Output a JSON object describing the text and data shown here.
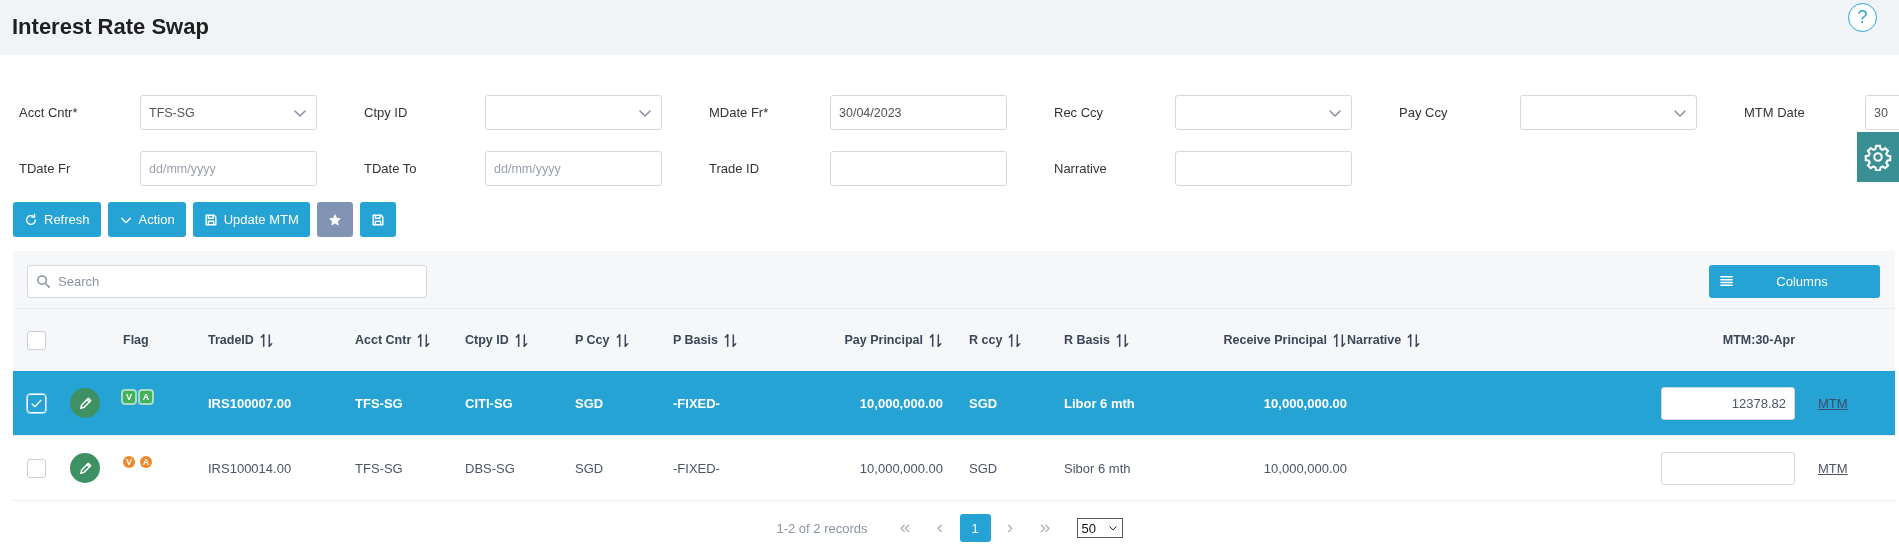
{
  "title": "Interest Rate Swap",
  "help": "?",
  "filters": [
    {
      "label": "Acct Cntr*",
      "kind": "select",
      "value": "TFS-SG"
    },
    {
      "label": "Ctpy ID",
      "kind": "select"
    },
    {
      "label": "MDate Fr*",
      "kind": "text",
      "value": "30/04/2023"
    },
    {
      "label": "Rec Ccy",
      "kind": "select"
    },
    {
      "label": "Pay Ccy",
      "kind": "select"
    },
    {
      "label": "MTM Date",
      "kind": "text",
      "value": "30"
    },
    {
      "label": "TDate Fr",
      "kind": "text",
      "placeholder": "dd/mm/yyyy"
    },
    {
      "label": "TDate To",
      "kind": "text",
      "placeholder": "dd/mm/yyyy"
    },
    {
      "label": "Trade ID",
      "kind": "text"
    },
    {
      "label": "Narrative",
      "kind": "text"
    }
  ],
  "toolbar": [
    {
      "label": "Refresh",
      "kind": "primary"
    },
    {
      "label": "Action",
      "kind": "primary"
    },
    {
      "label": "Update MTM",
      "kind": "primary"
    },
    {
      "kind": "muted"
    },
    {
      "kind": "primary"
    }
  ],
  "table": {
    "search": {
      "placeholder": "Search"
    },
    "columns_button": "Columns",
    "header_checked": false,
    "columns": [
      {
        "label": "Flag",
        "sortable": false
      },
      {
        "label": "TradeID",
        "sortable": true
      },
      {
        "label": "Acct Cntr",
        "sortable": true
      },
      {
        "label": "Ctpy ID",
        "sortable": true
      },
      {
        "label": "P Ccy",
        "sortable": true
      },
      {
        "label": "P Basis",
        "sortable": true
      },
      {
        "label": "Pay Principal",
        "sortable": true,
        "kind": "amount"
      },
      {
        "label": "R ccy",
        "sortable": true
      },
      {
        "label": "R Basis",
        "sortable": true
      },
      {
        "label": "Receive Principal",
        "sortable": true,
        "kind": "amount"
      },
      {
        "label": "Narrative",
        "sortable": true
      },
      {
        "label": "MTM:30-Apr",
        "sortable": false,
        "kind": "amount"
      }
    ],
    "rows": [
      {
        "selected": true,
        "checked": true,
        "flags": [
          {
            "label": "V",
            "kind": "box",
            "color": "#43b15a"
          },
          {
            "label": "A",
            "kind": "box",
            "color": "#43b15a"
          }
        ],
        "cells": [
          "",
          "IRS100007.00",
          "TFS-SG",
          "CITI-SG",
          "SGD",
          "-FIXED-",
          "10,000,000.00",
          "SGD",
          "Libor 6 mth",
          "10,000,000.00"
        ],
        "mtm": "12378.82",
        "link": "MTM"
      },
      {
        "selected": false,
        "checked": false,
        "flags": [
          {
            "label": "V",
            "kind": "dot",
            "color": "#f0882a"
          },
          {
            "label": "A",
            "kind": "dot",
            "color": "#f0882a"
          }
        ],
        "cells": [
          "",
          "IRS100014.00",
          "TFS-SG",
          "DBS-SG",
          "SGD",
          "-FIXED-",
          "10,000,000.00",
          "SGD",
          "Sibor 6 mth",
          "10,000,000.00"
        ],
        "link": "MTM"
      }
    ]
  },
  "pager": {
    "summary": "1-2 of 2 records",
    "first": {
      "label": "«",
      "disabled": true
    },
    "prev": {
      "label": "‹",
      "disabled": true
    },
    "pages": [
      {
        "label": "1",
        "selected": true
      }
    ],
    "next": {
      "label": "›",
      "disabled": true
    },
    "last": {
      "label": "»",
      "disabled": true
    },
    "page_size": "50"
  }
}
